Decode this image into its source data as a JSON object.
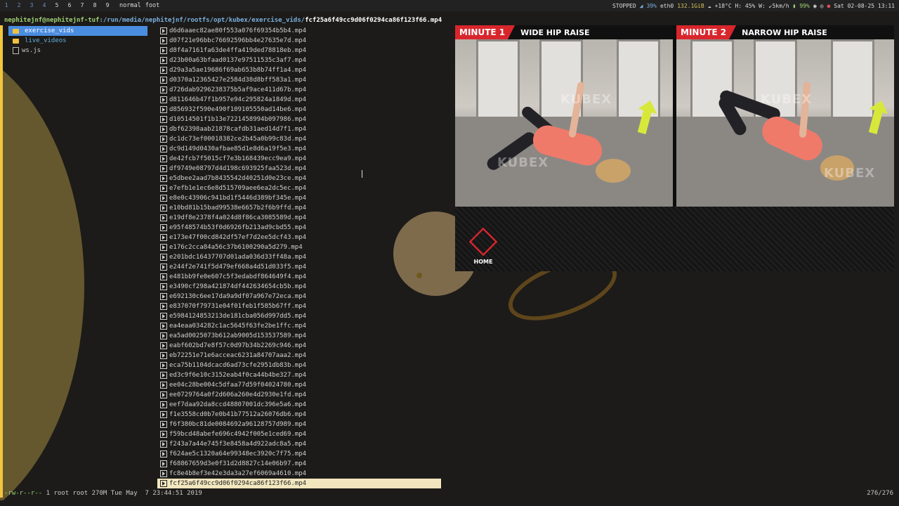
{
  "topbar": {
    "workspaces": [
      "1",
      "2",
      "3",
      "4",
      "5",
      "6",
      "7",
      "8",
      "9"
    ],
    "mode": "normal",
    "window_title": "foot",
    "status": {
      "player": "STOPPED",
      "volume": "39%",
      "net_iface": "eth0",
      "net_total": "132.1GiB",
      "weather": "+18°C H: 45% W: ↙5km/h",
      "battery": "99%",
      "datetime": "Sat 02-08-25 13:11"
    }
  },
  "terminal": {
    "prompt_user": "nephitejnf@nephitejnf-tuf",
    "prompt_path": ":/run/media/nephitejnf/rootfs/opt/kubex/exercise_vids/",
    "prompt_file": "fcf25a6f49cc9d06f0294ca86f123f66.mp4",
    "dirs": [
      {
        "name": "exercise_vids",
        "type": "folder",
        "selected": true
      },
      {
        "name": "live_videos",
        "type": "folder",
        "selected": false
      },
      {
        "name": "ws.js",
        "type": "file",
        "selected": false
      }
    ],
    "files": [
      "d6d6aaec82ae80f553a076f69354b5b4.mp4",
      "d07f21e96bbc76692596bb4e27635e7d.mp4",
      "d8f4a7161fa63de4ffa419ded78818eb.mp4",
      "d23b00a63bfaad0137e97511535c3af7.mp4",
      "d29a3a5ae19686f69ab653b8b74ff1a4.mp4",
      "d0370a12365427e2584d38d8bff583a1.mp4",
      "d726dab9296238375b5af9ace411d67b.mp4",
      "d811646b47f1b957e94c295824a1849d.mp4",
      "d856932f590e490f109105550ad14be6.mp4",
      "d10514501f1b13e7221458994b097986.mp4",
      "dbf62398aab21878cafdb31aed14d7f1.mp4",
      "dc1dc73ef00018382ce2b45a0b99c83d.mp4",
      "dc9d149d0430afbae85d1e8d6a19f5e3.mp4",
      "de42fcb7f5015cf7e3b168439ecc9ea9.mp4",
      "df9749e08797d4d198c693925faa523d.mp4",
      "e5dbee2aad7b8435542d40251d0e23ce.mp4",
      "e7efb1e1ec6e8d515709aee6ea2dc5ec.mp4",
      "e8e0c43906c941bd1f5446d389bf345e.mp4",
      "e10bd81b15bad99538e6657b2f6b9ffd.mp4",
      "e19df8e2378f4a024d8f86ca3085589d.mp4",
      "e95f48574b53f0d6926fb213ad9cbd55.mp4",
      "e173e47f00cd842df57ef7d2ee5dcf43.mp4",
      "e176c2cca84a56c37b6100290a5d279.mp4",
      "e201bdc16437707d01ada036d33ff48a.mp4",
      "e244f2e741f5d479ef668a4d51d033f5.mp4",
      "e481bb9fe0e607c5f3edabdf864649f4.mp4",
      "e3490cf298a421874df442634654cb5b.mp4",
      "e692130c6ee17da9a9df07a967e72eca.mp4",
      "e837070f79731e04f01feb1f585b67ff.mp4",
      "e5984124853213de181cba056d997dd5.mp4",
      "ea4eaa034282c1ac5645f63fe2be1ffc.mp4",
      "ea5ad0025073b612ab9005d153537589.mp4",
      "eabf602bd7e8f57c0d97b34b2269c946.mp4",
      "eb72251e71e6acceac6231a84707aaa2.mp4",
      "eca75b1104dcacd6ad73cfe2951db83b.mp4",
      "ed3c9f6e10c3152eab4f0ca44b4be327.mp4",
      "ee04c28be004c5dfaa77d59f04024780.mp4",
      "ee0729764a0f2d606a260e4d2930e1fd.mp4",
      "eef7daa92da8ccd48807001dc396e5a6.mp4",
      "f1e3558cd0b7e0b41b77512a26076db6.mp4",
      "f6f380bc81de0084692a96128757d989.mp4",
      "f59bcd48abefe696c4942f005e1ced69.mp4",
      "f243a7a44e745f3e8458a4d922adc8a5.mp4",
      "f624ae5c1320a64e99348ec3920c7f75.mp4",
      "f68867659d3e0f31d2d8827c14e06b97.mp4",
      "fc8e4b8ef3e42e3da3a27ef6069a4610.mp4",
      "fcf25a6f49cc9d06f0294ca86f123f66.mp4"
    ],
    "selected_index": 46,
    "file_info_perm": "-rw-r--r--",
    "file_info_rest": " 1 root root 270M Tue May  7 23:44:51 2019",
    "file_count": "276/276"
  },
  "preview": {
    "clips": [
      {
        "minute": "MINUTE 1",
        "exercise": "WIDE HIP RAISE"
      },
      {
        "minute": "MINUTE 2",
        "exercise": "NARROW HIP RAISE"
      }
    ],
    "watermark": "KUBEX",
    "home_label": "HOME",
    "accent_color": "#d8262c"
  }
}
